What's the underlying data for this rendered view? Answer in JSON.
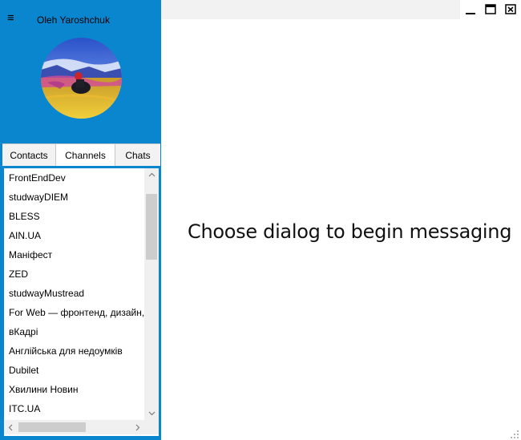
{
  "header": {
    "menu_icon": "hamburger-icon",
    "menu_glyph": "≡",
    "user_name": "Oleh Yaroshchuk",
    "avatar_icon": "user-avatar-photo"
  },
  "tabs": [
    {
      "label": "Contacts",
      "active": false
    },
    {
      "label": "Channels",
      "active": true
    },
    {
      "label": "Chats",
      "active": false
    }
  ],
  "channels": [
    "FrontEndDev",
    "studwayDIEM",
    "BLESS",
    "AIN.UA",
    "Маніфест",
    "ZED",
    "studwayMustread",
    "For Web — фронтенд, дизайн,",
    "вКадрі",
    "Англійська для недоумків",
    "Dubilet",
    "Хвилини Новин",
    "ITC.UA"
  ],
  "main": {
    "placeholder": "Choose dialog to begin messaging"
  },
  "window_controls": {
    "minimize_icon": "minimize-icon",
    "maximize_icon": "maximize-icon",
    "close_icon": "close-icon"
  },
  "colors": {
    "accent": "#0a86cf",
    "title_bar": "#f2f2f2",
    "scrollbar_track": "#f0f0f0",
    "scrollbar_thumb": "#cdcdcd"
  }
}
